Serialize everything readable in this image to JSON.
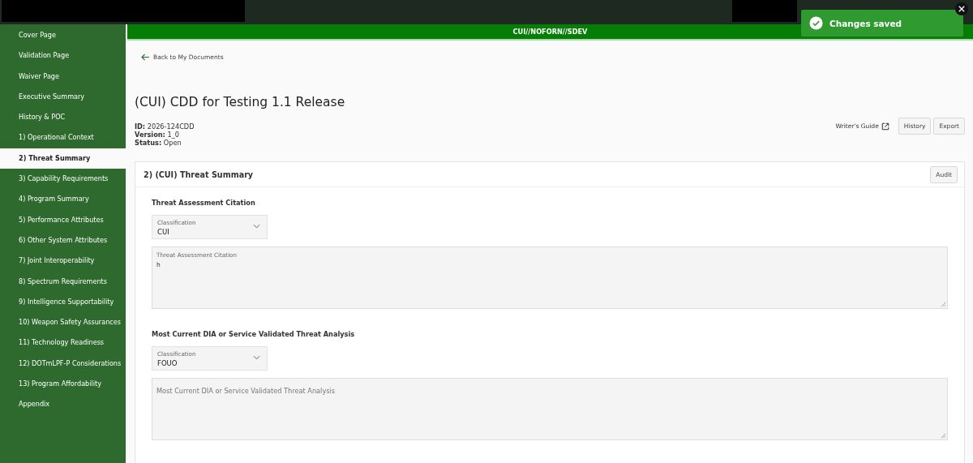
{
  "sidebar": {
    "items": [
      {
        "label": "Cover Page",
        "selected": false
      },
      {
        "label": "Validation Page",
        "selected": false
      },
      {
        "label": "Waiver Page",
        "selected": false
      },
      {
        "label": "Executive Summary",
        "selected": false
      },
      {
        "label": "History & POC",
        "selected": false
      },
      {
        "label": "1) Operational Context",
        "selected": false
      },
      {
        "label": "2) Threat Summary",
        "selected": true
      },
      {
        "label": "3) Capability Requirements",
        "selected": false
      },
      {
        "label": "4) Program Summary",
        "selected": false
      },
      {
        "label": "5) Performance Attributes",
        "selected": false
      },
      {
        "label": "6) Other System Attributes",
        "selected": false
      },
      {
        "label": "7) Joint Interoperability",
        "selected": false
      },
      {
        "label": "8) Spectrum Requirements",
        "selected": false
      },
      {
        "label": "9) Intelligence Supportability",
        "selected": false
      },
      {
        "label": "10) Weapon Safety Assurances",
        "selected": false
      },
      {
        "label": "11) Technology Readiness",
        "selected": false
      },
      {
        "label": "12) DOTmLPF-P Considerations",
        "selected": false
      },
      {
        "label": "13) Program Affordability",
        "selected": false
      },
      {
        "label": "Appendix",
        "selected": false
      }
    ]
  },
  "banner": "CUI//NOFORN//SDEV",
  "toast": {
    "message": "Changes saved"
  },
  "back_link": "Back to My Documents",
  "document": {
    "title": "(CUI) CDD for Testing 1.1 Release",
    "meta": [
      {
        "label": "ID:",
        "value": "2026-124CDD"
      },
      {
        "label": "Version:",
        "value": "1_0"
      },
      {
        "label": "Status:",
        "value": "Open"
      }
    ],
    "writers_guide": "Writer's Guide",
    "buttons": [
      "History",
      "Export"
    ]
  },
  "panel": {
    "title": "2) (CUI) Threat Summary",
    "audit_button": "Audit",
    "sections": [
      {
        "heading": "Threat Assessment Citation",
        "classification_label": "Classification",
        "classification_value": "CUI",
        "text_label": "Threat Assessment Citation",
        "text_value": "h"
      },
      {
        "heading": "Most Current DIA or Service Validated Threat Analysis",
        "classification_label": "Classification",
        "classification_value": "FOUO",
        "placeholder": "Most Current DIA or Service Validated Threat Analysis"
      }
    ]
  }
}
